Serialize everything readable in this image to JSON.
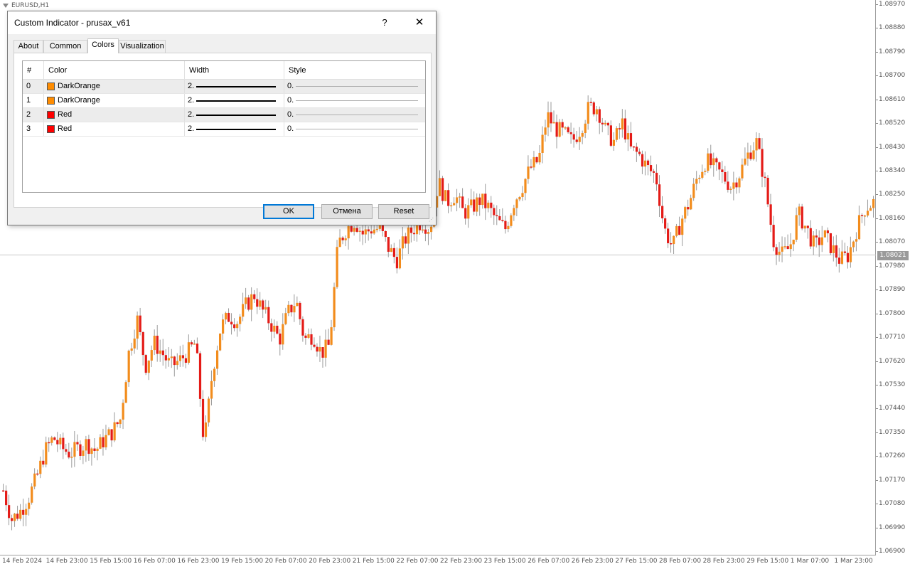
{
  "chart": {
    "symbol": "EURUSD,H1",
    "current_price": "1.08021",
    "colors": {
      "up": "#f28c1c",
      "down": "#e41b17",
      "wick": "#9a9a9a"
    },
    "price_ticks": [
      "1.08970",
      "1.08880",
      "1.08790",
      "1.08700",
      "1.08610",
      "1.08520",
      "1.08430",
      "1.08340",
      "1.08250",
      "1.08160",
      "1.08070",
      "1.07980",
      "1.07890",
      "1.07800",
      "1.07710",
      "1.07620",
      "1.07530",
      "1.07440",
      "1.07350",
      "1.07260",
      "1.07170",
      "1.07080",
      "1.06990",
      "1.06900"
    ],
    "time_ticks": [
      "14 Feb 2024",
      "14 Feb 23:00",
      "15 Feb 15:00",
      "16 Feb 07:00",
      "16 Feb 23:00",
      "19 Feb 15:00",
      "20 Feb 07:00",
      "20 Feb 23:00",
      "21 Feb 15:00",
      "22 Feb 07:00",
      "22 Feb 23:00",
      "23 Feb 15:00",
      "26 Feb 07:00",
      "26 Feb 23:00",
      "27 Feb 15:00",
      "28 Feb 07:00",
      "28 Feb 23:00",
      "29 Feb 15:00",
      "1 Mar 07:00",
      "1 Mar 23:00"
    ],
    "price_range": [
      1.069,
      1.0897
    ],
    "close_path": [
      1.0713,
      1.0702,
      1.0705,
      1.071,
      1.0718,
      1.0728,
      1.0733,
      1.0729,
      1.0727,
      1.0729,
      1.0731,
      1.0728,
      1.0732,
      1.0735,
      1.074,
      1.0765,
      1.0778,
      1.076,
      1.0769,
      1.0765,
      1.076,
      1.0762,
      1.0765,
      1.0769,
      1.073,
      1.0758,
      1.0775,
      1.0779,
      1.0777,
      1.0783,
      1.0787,
      1.0781,
      1.0776,
      1.077,
      1.078,
      1.0785,
      1.077,
      1.0772,
      1.0765,
      1.0768,
      1.0806,
      1.0812,
      1.0815,
      1.081,
      1.0812,
      1.0812,
      1.0805,
      1.08,
      1.0808,
      1.0812,
      1.0815,
      1.0812,
      1.083,
      1.0822,
      1.0825,
      1.0818,
      1.082,
      1.0823,
      1.082,
      1.0815,
      1.0812,
      1.0822,
      1.0828,
      1.0835,
      1.0838,
      1.0855,
      1.085,
      1.0848,
      1.0845,
      1.085,
      1.0858,
      1.0858,
      1.0849,
      1.0845,
      1.0852,
      1.0842,
      1.084,
      1.0835,
      1.0832,
      1.0812,
      1.0805,
      1.0815,
      1.0822,
      1.0832,
      1.0838,
      1.0835,
      1.0832,
      1.0828,
      1.0833,
      1.084,
      1.0845,
      1.083,
      1.0808,
      1.0802,
      1.0805,
      1.0818,
      1.0812,
      1.0805,
      1.081,
      1.0805,
      1.08,
      1.0802,
      1.0812,
      1.082,
      1.0822
    ]
  },
  "dialog": {
    "title": "Custom Indicator - prusax_v61",
    "help": "?",
    "close": "✕",
    "tabs": [
      "About",
      "Common",
      "Colors",
      "Visualization"
    ],
    "active_tab": "Colors",
    "grid": {
      "headers": [
        "#",
        "Color",
        "Width",
        "Style"
      ],
      "rows": [
        {
          "index": "0",
          "color_name": "DarkOrange",
          "color": "#ff8c00",
          "width": "2.",
          "style": "0."
        },
        {
          "index": "1",
          "color_name": "DarkOrange",
          "color": "#ff8c00",
          "width": "2.",
          "style": "0."
        },
        {
          "index": "2",
          "color_name": "Red",
          "color": "#ff0000",
          "width": "2.",
          "style": "0."
        },
        {
          "index": "3",
          "color_name": "Red",
          "color": "#ff0000",
          "width": "2.",
          "style": "0."
        }
      ]
    },
    "buttons": {
      "ok": "OK",
      "cancel": "Отмена",
      "reset": "Reset"
    }
  }
}
